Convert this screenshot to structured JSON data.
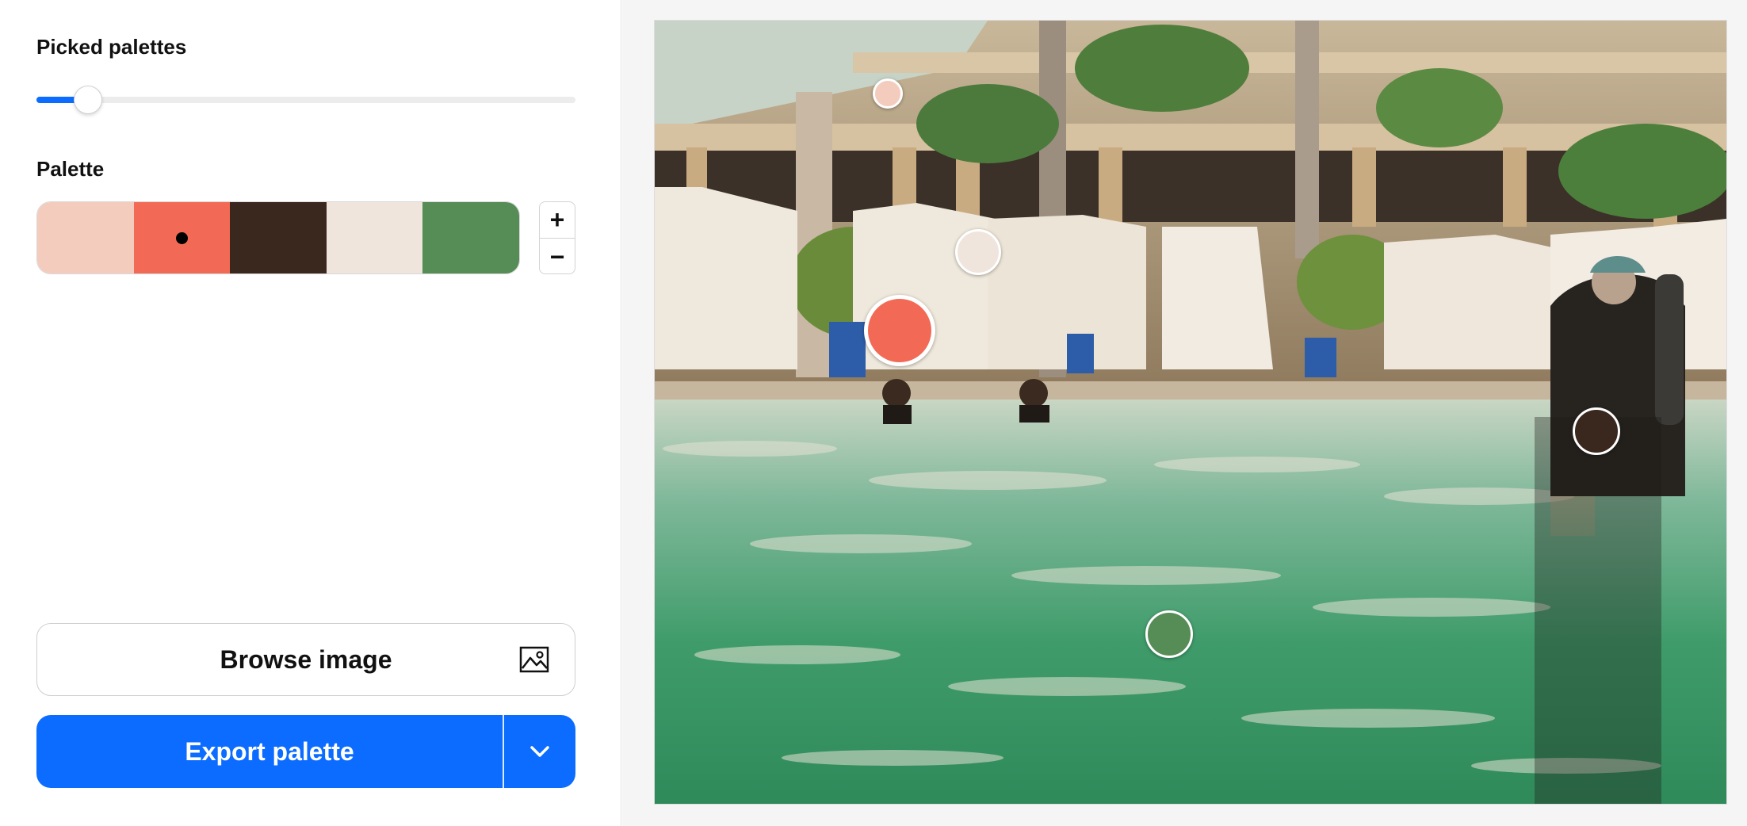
{
  "picked_palettes": {
    "title": "Picked palettes",
    "value": 0.095
  },
  "palette": {
    "title": "Palette",
    "swatches": [
      {
        "name": "blush",
        "color": "#F4CCBE",
        "selected": false
      },
      {
        "name": "coral",
        "color": "#F26A55",
        "selected": true
      },
      {
        "name": "dark-brown",
        "color": "#3A271E",
        "selected": false
      },
      {
        "name": "cream",
        "color": "#F0E5DC",
        "selected": false
      },
      {
        "name": "green",
        "color": "#568C55",
        "selected": false
      }
    ],
    "add_symbol": "+",
    "remove_symbol": "−"
  },
  "browse": {
    "label": "Browse image",
    "icon": "image-icon"
  },
  "export": {
    "label": "Export palette",
    "menu_icon": "chevron-down-icon",
    "color": "#0B6CFF"
  }
}
